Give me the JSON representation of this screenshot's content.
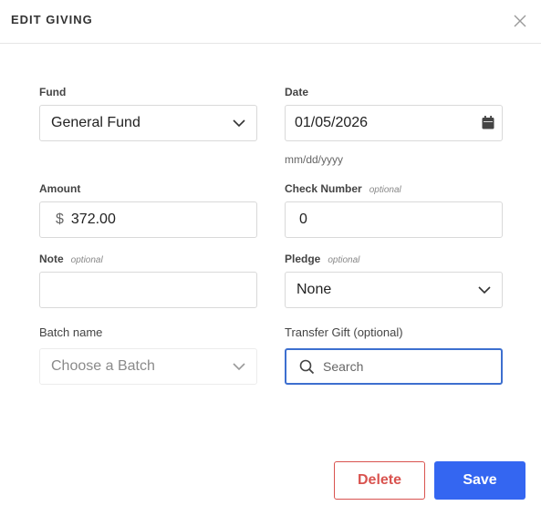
{
  "dialog": {
    "title": "EDIT GIVING"
  },
  "fields": {
    "fund": {
      "label": "Fund",
      "value": "General Fund"
    },
    "date": {
      "label": "Date",
      "value": "01/05/2026",
      "hint": "mm/dd/yyyy"
    },
    "amount": {
      "label": "Amount",
      "currency": "$",
      "value": "372.00"
    },
    "check_number": {
      "label": "Check Number",
      "optional": "optional",
      "value": "0"
    },
    "note": {
      "label": "Note",
      "optional": "optional",
      "value": ""
    },
    "pledge": {
      "label": "Pledge",
      "optional": "optional",
      "value": "None"
    },
    "batch": {
      "label": "Batch name",
      "placeholder": "Choose a Batch"
    },
    "transfer": {
      "label": "Transfer Gift (optional)",
      "placeholder": "Search"
    }
  },
  "actions": {
    "delete_label": "Delete",
    "save_label": "Save"
  },
  "colors": {
    "accent": "#3466f1",
    "danger": "#d9534f",
    "focus_border": "#3d6fcf"
  }
}
